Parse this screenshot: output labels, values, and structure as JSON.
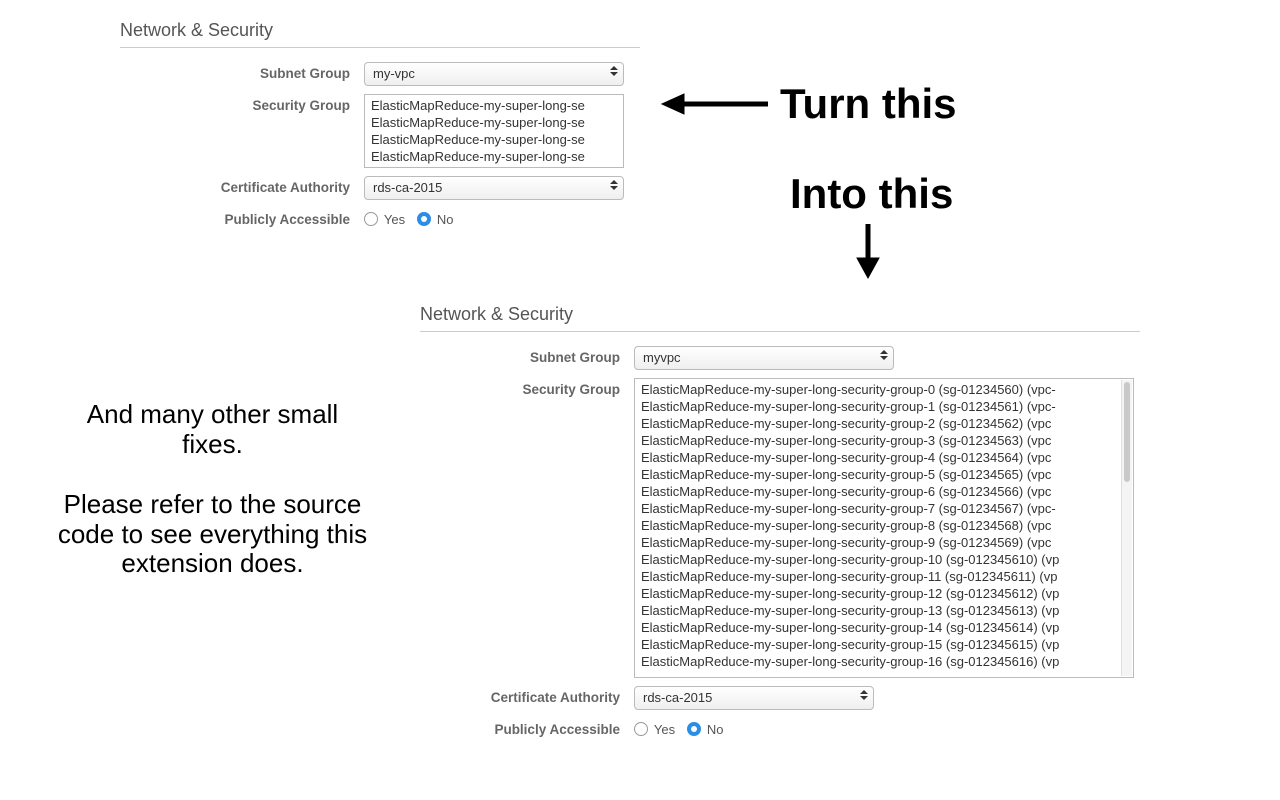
{
  "before": {
    "heading": "Network & Security",
    "labels": {
      "subnet_group": "Subnet Group",
      "security_group": "Security Group",
      "cert_authority": "Certificate Authority",
      "publicly_accessible": "Publicly Accessible"
    },
    "subnet_group_value": "my-vpc",
    "security_group_options": [
      "ElasticMapReduce-my-super-long-se",
      "ElasticMapReduce-my-super-long-se",
      "ElasticMapReduce-my-super-long-se",
      "ElasticMapReduce-my-super-long-se"
    ],
    "cert_authority_value": "rds-ca-2015",
    "publicly_accessible": {
      "yes": "Yes",
      "no": "No",
      "selected": "no"
    }
  },
  "after": {
    "heading": "Network & Security",
    "labels": {
      "subnet_group": "Subnet Group",
      "security_group": "Security Group",
      "cert_authority": "Certificate Authority",
      "publicly_accessible": "Publicly Accessible"
    },
    "subnet_group_value": "myvpc",
    "security_group_options": [
      "ElasticMapReduce-my-super-long-security-group-0 (sg-01234560) (vpc-",
      "ElasticMapReduce-my-super-long-security-group-1 (sg-01234561) (vpc-",
      "ElasticMapReduce-my-super-long-security-group-2 (sg-01234562) (vpc",
      "ElasticMapReduce-my-super-long-security-group-3 (sg-01234563) (vpc",
      "ElasticMapReduce-my-super-long-security-group-4 (sg-01234564) (vpc",
      "ElasticMapReduce-my-super-long-security-group-5 (sg-01234565) (vpc",
      "ElasticMapReduce-my-super-long-security-group-6 (sg-01234566) (vpc",
      "ElasticMapReduce-my-super-long-security-group-7 (sg-01234567) (vpc-",
      "ElasticMapReduce-my-super-long-security-group-8 (sg-01234568) (vpc",
      "ElasticMapReduce-my-super-long-security-group-9 (sg-01234569) (vpc",
      "ElasticMapReduce-my-super-long-security-group-10 (sg-012345610) (vp",
      "ElasticMapReduce-my-super-long-security-group-11 (sg-012345611) (vp",
      "ElasticMapReduce-my-super-long-security-group-12 (sg-012345612) (vp",
      "ElasticMapReduce-my-super-long-security-group-13 (sg-012345613) (vp",
      "ElasticMapReduce-my-super-long-security-group-14 (sg-012345614) (vp",
      "ElasticMapReduce-my-super-long-security-group-15 (sg-012345615) (vp",
      "ElasticMapReduce-my-super-long-security-group-16 (sg-012345616) (vp"
    ],
    "cert_authority_value": "rds-ca-2015",
    "publicly_accessible": {
      "yes": "Yes",
      "no": "No",
      "selected": "no"
    }
  },
  "annotations": {
    "turn_this": "Turn this",
    "into_this": "Into this",
    "side_text": "And many other small fixes.\n\nPlease refer to the source code to see everything this extension does."
  }
}
